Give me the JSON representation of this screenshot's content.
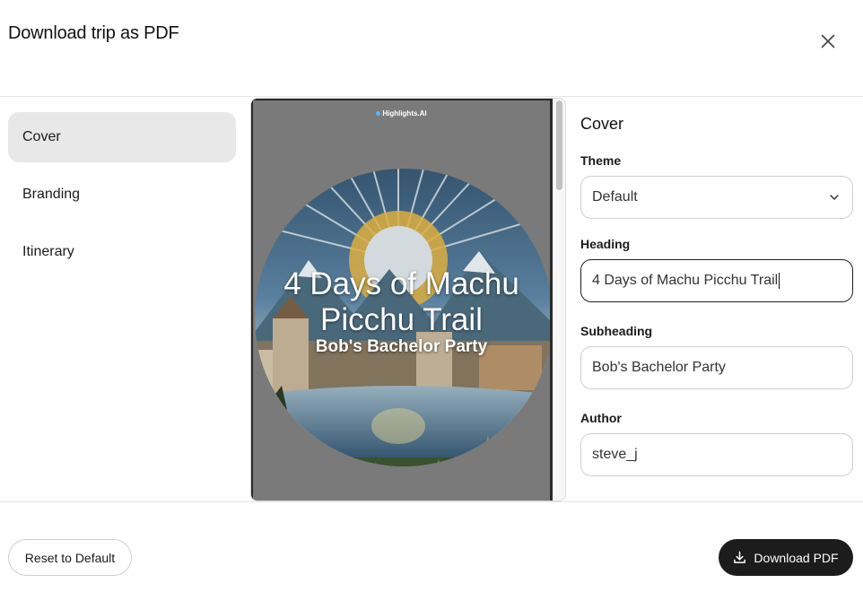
{
  "dialog": {
    "title": "Download trip as PDF",
    "close_icon": "close-icon"
  },
  "sidebar": {
    "items": [
      {
        "label": "Cover",
        "active": true
      },
      {
        "label": "Branding",
        "active": false
      },
      {
        "label": "Itinerary",
        "active": false
      }
    ]
  },
  "preview": {
    "brand": "Highlights.AI",
    "heading": "4 Days of Machu Picchu Trail",
    "subheading": "Bob's Bachelor Party"
  },
  "form": {
    "section_title": "Cover",
    "theme_label": "Theme",
    "theme_value": "Default",
    "heading_label": "Heading",
    "heading_value": "4 Days of Machu Picchu Trail",
    "subheading_label": "Subheading",
    "subheading_value": "Bob's Bachelor Party",
    "author_label": "Author",
    "author_value": "steve_j"
  },
  "footer": {
    "reset_label": "Reset to Default",
    "download_label": "Download PDF",
    "download_icon": "download-icon"
  },
  "colors": {
    "active_item_bg": "#e8e8e9",
    "primary_button": "#1c1c1c",
    "border": "#cfcfcf"
  }
}
